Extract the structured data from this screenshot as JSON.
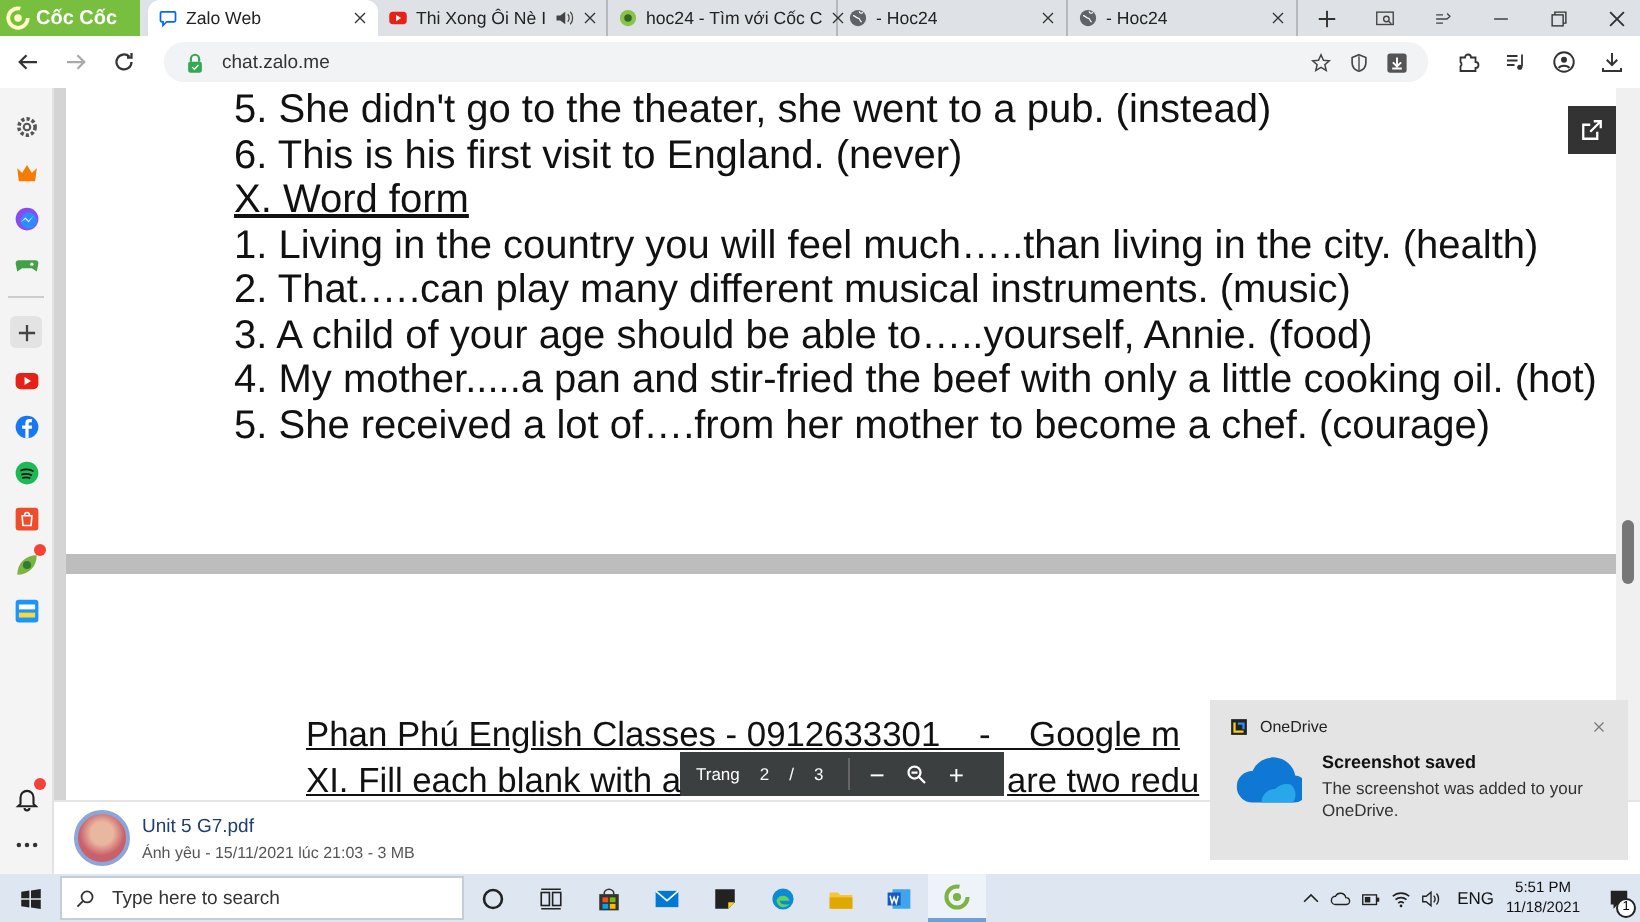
{
  "browser": {
    "brand": "Cốc Cốc",
    "tabs": [
      {
        "kind": "zalo",
        "title": "Zalo Web",
        "selected": true,
        "audio": false
      },
      {
        "kind": "youtube",
        "title": "Thi Xong Ôi Nè I",
        "selected": false,
        "audio": true
      },
      {
        "kind": "hoc24",
        "title": "hoc24 - Tìm với Cốc C",
        "selected": false,
        "audio": false
      },
      {
        "kind": "globe",
        "title": "- Hoc24",
        "selected": false,
        "audio": false
      },
      {
        "kind": "globe",
        "title": "- Hoc24",
        "selected": false,
        "audio": false
      }
    ],
    "address": "chat.zalo.me"
  },
  "sidebar": {
    "items": [
      {
        "kind": "gear",
        "badge": false
      },
      {
        "kind": "crown",
        "badge": false
      },
      {
        "kind": "messenger",
        "badge": false
      },
      {
        "kind": "gamepad",
        "badge": false
      },
      {
        "kind": "divider"
      },
      {
        "kind": "plus",
        "badge": false
      },
      {
        "kind": "youtube",
        "badge": false
      },
      {
        "kind": "facebook",
        "badge": false
      },
      {
        "kind": "spotify",
        "badge": false
      },
      {
        "kind": "shopee",
        "badge": false
      },
      {
        "kind": "leaf",
        "badge": true
      },
      {
        "kind": "tiki",
        "badge": false
      }
    ],
    "bottom_items": [
      {
        "kind": "bell",
        "badge": true
      },
      {
        "kind": "more",
        "badge": false
      }
    ]
  },
  "document": {
    "pages": [
      {
        "lines": [
          {
            "text": "5. She didn't go to the theater, she went to a pub. (instead)",
            "underline": false
          },
          {
            "text": "6. This is his first visit to England. (never)",
            "underline": false
          },
          {
            "text": "X. Word form",
            "underline": true
          },
          {
            "text": "1. Living in the country you will feel much…..than living in the city. (health)",
            "underline": false
          },
          {
            "text": "2. That.….can play many different musical instruments. (music)",
            "underline": false
          },
          {
            "text": "3. A child of your age should be able to…..yourself, Annie. (food)",
            "underline": false
          },
          {
            "text": "4. My mother.....a pan and stir-fried the beef with only a little cooking oil. (hot)",
            "underline": false
          },
          {
            "text": "5. She received a lot of….from her mother to become a chef. (courage)",
            "underline": false
          }
        ]
      },
      {
        "lines": [
          {
            "text": "Phan Phú English Classes - 0912633301    -    Google m",
            "underline": true
          },
          {
            "parts": [
              "XI. Fill each blank with a",
              "are two redu"
            ],
            "underline": true
          }
        ]
      }
    ],
    "pager": {
      "label": "Trang",
      "page": "2",
      "separator": "/",
      "total": "3",
      "zoom_out": "−",
      "zoom_in": "+"
    }
  },
  "file": {
    "name": "Unit 5 G7.pdf",
    "meta": "Ánh yêu - 15/11/2021 lúc 21:03 - 3 MB"
  },
  "toast": {
    "app": "OneDrive",
    "title": "Screenshot saved",
    "message": "The screenshot was added to your OneDrive."
  },
  "taskbar": {
    "search_placeholder": "Type here to search",
    "apps": [
      {
        "kind": "cortana",
        "active": false
      },
      {
        "kind": "taskview",
        "active": false
      },
      {
        "kind": "store",
        "active": false
      },
      {
        "kind": "mail",
        "active": false
      },
      {
        "kind": "sticky",
        "active": false
      },
      {
        "kind": "edge",
        "active": false
      },
      {
        "kind": "folder",
        "active": false
      },
      {
        "kind": "word",
        "active": false
      },
      {
        "kind": "coccoc",
        "active": true
      }
    ],
    "language": "ENG",
    "time": "5:51 PM",
    "date": "11/18/2021",
    "notifications": "1"
  }
}
